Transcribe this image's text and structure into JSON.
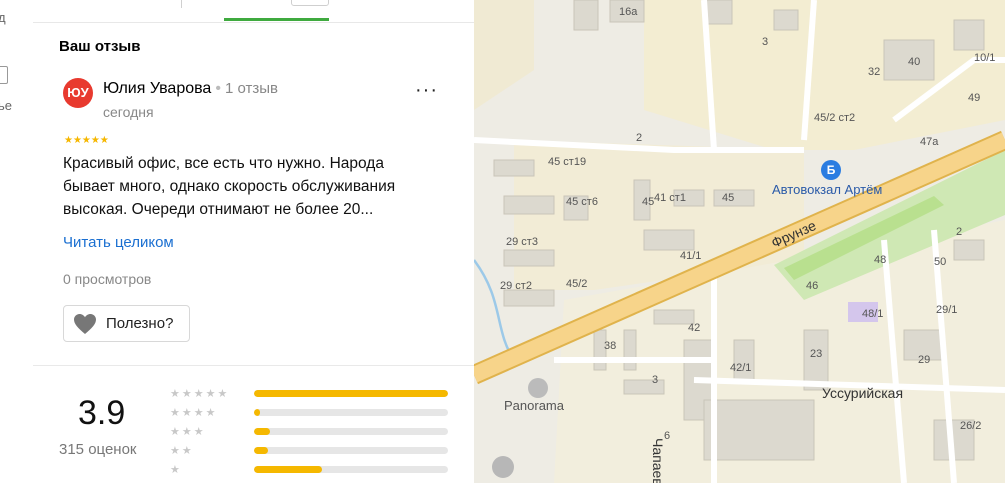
{
  "leftbar": {
    "frag_top": "д",
    "frag_bottom": "ье"
  },
  "review": {
    "section_title": "Ваш отзыв",
    "avatar_initials": "ЮУ",
    "author_name": "Юлия Уварова",
    "author_reviews": "1 отзыв",
    "date": "сегодня",
    "more_glyph": "···",
    "stars": "★★★★★",
    "rating_value": 5,
    "text": "Красивый офис, все есть что нужно. Народа бывает много, однако скорость обслуживания высокая. Очереди отнимают не более 20...",
    "read_more": "Читать целиком",
    "views": "0 просмотров",
    "useful_label": "Полезно?"
  },
  "summary": {
    "rating": "3.9",
    "count": "315 оценок",
    "distribution": [
      {
        "stars": "★★★★★",
        "fraction": 1.0
      },
      {
        "stars": "★★★★",
        "fraction": 0.03
      },
      {
        "stars": "★★★",
        "fraction": 0.08
      },
      {
        "stars": "★★",
        "fraction": 0.07
      },
      {
        "stars": "★",
        "fraction": 0.35
      }
    ]
  },
  "colors": {
    "accent_green": "#3faa3f",
    "star": "#f5b800",
    "link": "#1a6fd1",
    "avatar": "#e83a2f",
    "road": "#f5c96a"
  },
  "map": {
    "streets": {
      "frunze": "Фрунзе",
      "ussuri": "Уссурийская",
      "chapaeva": "Чапаева"
    },
    "poi": {
      "bus_station": "Автовокзал Артём",
      "panorama": "Panorama",
      "bus_icon": "Б"
    },
    "houses": [
      "16а",
      "3",
      "32",
      "40",
      "10/1",
      "49",
      "45/2 ст2",
      "47а",
      "2",
      "45 ст19",
      "45",
      "45 ст6",
      "41 ст1",
      "45",
      "41/1",
      "29 ст3",
      "29 ст2",
      "45/2",
      "48",
      "50",
      "2",
      "46",
      "48/1",
      "29/1",
      "42",
      "38",
      "3",
      "23",
      "42/1",
      "29",
      "6",
      "26/2"
    ]
  }
}
